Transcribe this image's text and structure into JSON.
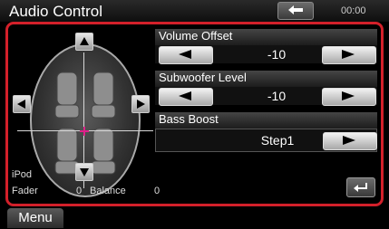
{
  "header": {
    "title": "Audio Control",
    "clock": "00:00",
    "back_icon": "back-arrow-icon"
  },
  "seat_panel": {
    "source": "iPod",
    "fader_label": "Fader",
    "fader_value": "0",
    "balance_label": "Balance",
    "balance_value": "0"
  },
  "volume_offset": {
    "label": "Volume Offset",
    "value": "-10"
  },
  "subwoofer_level": {
    "label": "Subwoofer Level",
    "value": "-10"
  },
  "bass_boost": {
    "label": "Bass Boost",
    "value": "Step1"
  },
  "footer": {
    "menu_label": "Menu"
  },
  "colors": {
    "frame": "#d3202a",
    "background": "#000000"
  }
}
